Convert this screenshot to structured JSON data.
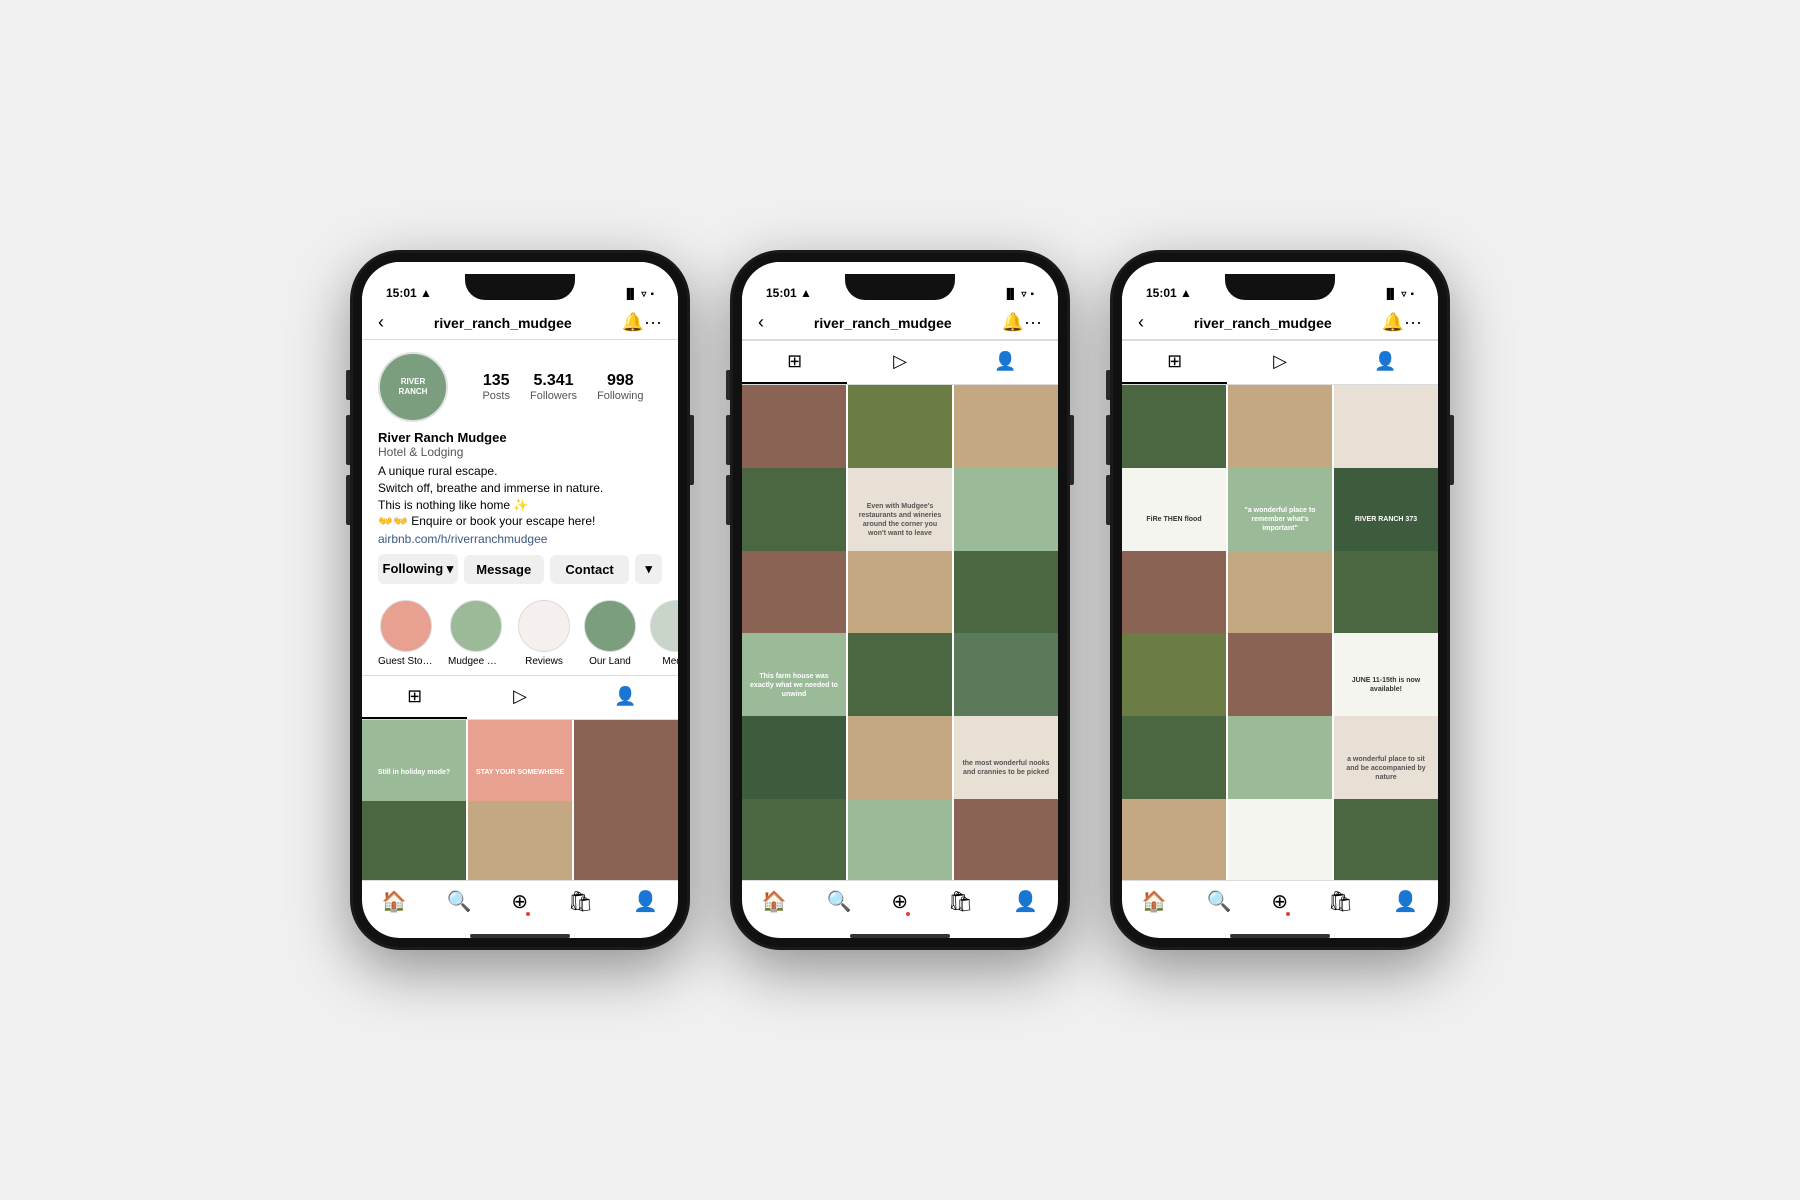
{
  "colors": {
    "sage": "#9aba98",
    "peach": "#e8a090",
    "brown": "#8b6355",
    "green": "#5a7a5a",
    "cream": "#e8e0d5",
    "darkgreen": "#3d5c3d",
    "white_bg": "#f5f5f0",
    "forest": "#4a6741"
  },
  "phones": [
    {
      "id": "phone1",
      "statusBar": {
        "time": "15:01",
        "icons": "▲ ▐▌ ▿ ▪"
      },
      "nav": {
        "username": "river_ranch_mudgee",
        "backIcon": "‹",
        "bellIcon": "🔔",
        "moreIcon": "···"
      },
      "profile": {
        "avatarText": "RIVER\nRANCH",
        "stats": [
          {
            "number": "135",
            "label": "Posts"
          },
          {
            "number": "5.341",
            "label": "Followers"
          },
          {
            "number": "998",
            "label": "Following"
          }
        ],
        "name": "River Ranch Mudgee",
        "category": "Hotel & Lodging",
        "bio": "A unique rural escape.\nSwitch off, breathe and immerse in nature.\nThis is nothing like home ✨\n👐👐 Enquire or book your escape here!",
        "link": "airbnb.com/h/riverranchmudgee"
      },
      "buttons": {
        "following": "Following ▾",
        "message": "Message",
        "contact": "Contact",
        "more": "▾"
      },
      "highlights": [
        {
          "label": "Guest Stories",
          "color": "orange"
        },
        {
          "label": "Mudgee Wi...",
          "color": "sage"
        },
        {
          "label": "Reviews",
          "color": "light"
        },
        {
          "label": "Our Land",
          "color": "green"
        },
        {
          "label": "Media",
          "color": "landscape"
        }
      ],
      "tabs": [
        "grid",
        "reels",
        "tagged"
      ],
      "activeTab": 0,
      "grid": [
        {
          "color": "c-sage",
          "text": "Still in holiday mode?"
        },
        {
          "color": "c-peach",
          "text": "STAY YOUR SOMEWHERE"
        },
        {
          "color": "c-brown",
          "text": ""
        },
        {
          "color": "c-forest",
          "text": ""
        },
        {
          "color": "c-tan",
          "text": ""
        },
        {
          "color": "c-brown",
          "text": ""
        }
      ]
    },
    {
      "id": "phone2",
      "statusBar": {
        "time": "15:01",
        "icons": "▲ ▐▌ ▿ ▪"
      },
      "nav": {
        "username": "river_ranch_mudgee",
        "backIcon": "‹",
        "bellIcon": "🔔",
        "moreIcon": "···"
      },
      "tabs": [
        "grid",
        "reels",
        "tagged"
      ],
      "activeTab": 0,
      "grid": [
        {
          "color": "c-brown",
          "text": ""
        },
        {
          "color": "c-olive",
          "text": ""
        },
        {
          "color": "c-tan",
          "text": ""
        },
        {
          "color": "c-forest",
          "text": ""
        },
        {
          "color": "c-cream",
          "text": "Even with Mudgee's restaurants and wineries around the corner you won't want to leave"
        },
        {
          "color": "c-sage",
          "text": ""
        },
        {
          "color": "c-brown",
          "text": ""
        },
        {
          "color": "c-tan",
          "text": ""
        },
        {
          "color": "c-forest",
          "text": ""
        },
        {
          "color": "c-sage",
          "text": "This farm house was exactly what we needed to unwind"
        },
        {
          "color": "c-forest",
          "text": ""
        },
        {
          "color": "c-green",
          "text": ""
        },
        {
          "color": "c-darkgreen",
          "text": ""
        },
        {
          "color": "c-tan",
          "text": ""
        },
        {
          "color": "c-cream",
          "text": "the most wonderful nooks and crannies to be picked"
        },
        {
          "color": "c-forest",
          "text": ""
        },
        {
          "color": "c-sage",
          "text": ""
        },
        {
          "color": "c-brown",
          "text": ""
        }
      ]
    },
    {
      "id": "phone3",
      "statusBar": {
        "time": "15:01",
        "icons": "▲ ▐▌ ▿ ▪"
      },
      "nav": {
        "username": "river_ranch_mudgee",
        "backIcon": "‹",
        "bellIcon": "🔔",
        "moreIcon": "···"
      },
      "tabs": [
        "grid",
        "reels",
        "tagged"
      ],
      "activeTab": 0,
      "grid": [
        {
          "color": "c-forest",
          "text": ""
        },
        {
          "color": "c-tan",
          "text": ""
        },
        {
          "color": "c-cream",
          "text": ""
        },
        {
          "color": "c-white",
          "text": "FiRe THEN flood"
        },
        {
          "color": "c-sage",
          "text": "\"a wonderful place to remember what's important\""
        },
        {
          "color": "c-darkgreen",
          "text": "RIVER RANCH 373"
        },
        {
          "color": "c-brown",
          "text": ""
        },
        {
          "color": "c-tan",
          "text": ""
        },
        {
          "color": "c-forest",
          "text": ""
        },
        {
          "color": "c-olive",
          "text": ""
        },
        {
          "color": "c-brown",
          "text": ""
        },
        {
          "color": "c-white",
          "text": "JUNE 11-15th is now available!"
        },
        {
          "color": "c-forest",
          "text": ""
        },
        {
          "color": "c-sage",
          "text": ""
        },
        {
          "color": "c-cream",
          "text": "a wonderful place to sit and be accompanied by nature"
        },
        {
          "color": "c-tan",
          "text": ""
        },
        {
          "color": "c-white",
          "text": ""
        },
        {
          "color": "c-forest",
          "text": ""
        }
      ]
    }
  ],
  "bottomNav": {
    "items": [
      "🏠",
      "🔍",
      "⊕",
      "🛍",
      "👤"
    ]
  }
}
